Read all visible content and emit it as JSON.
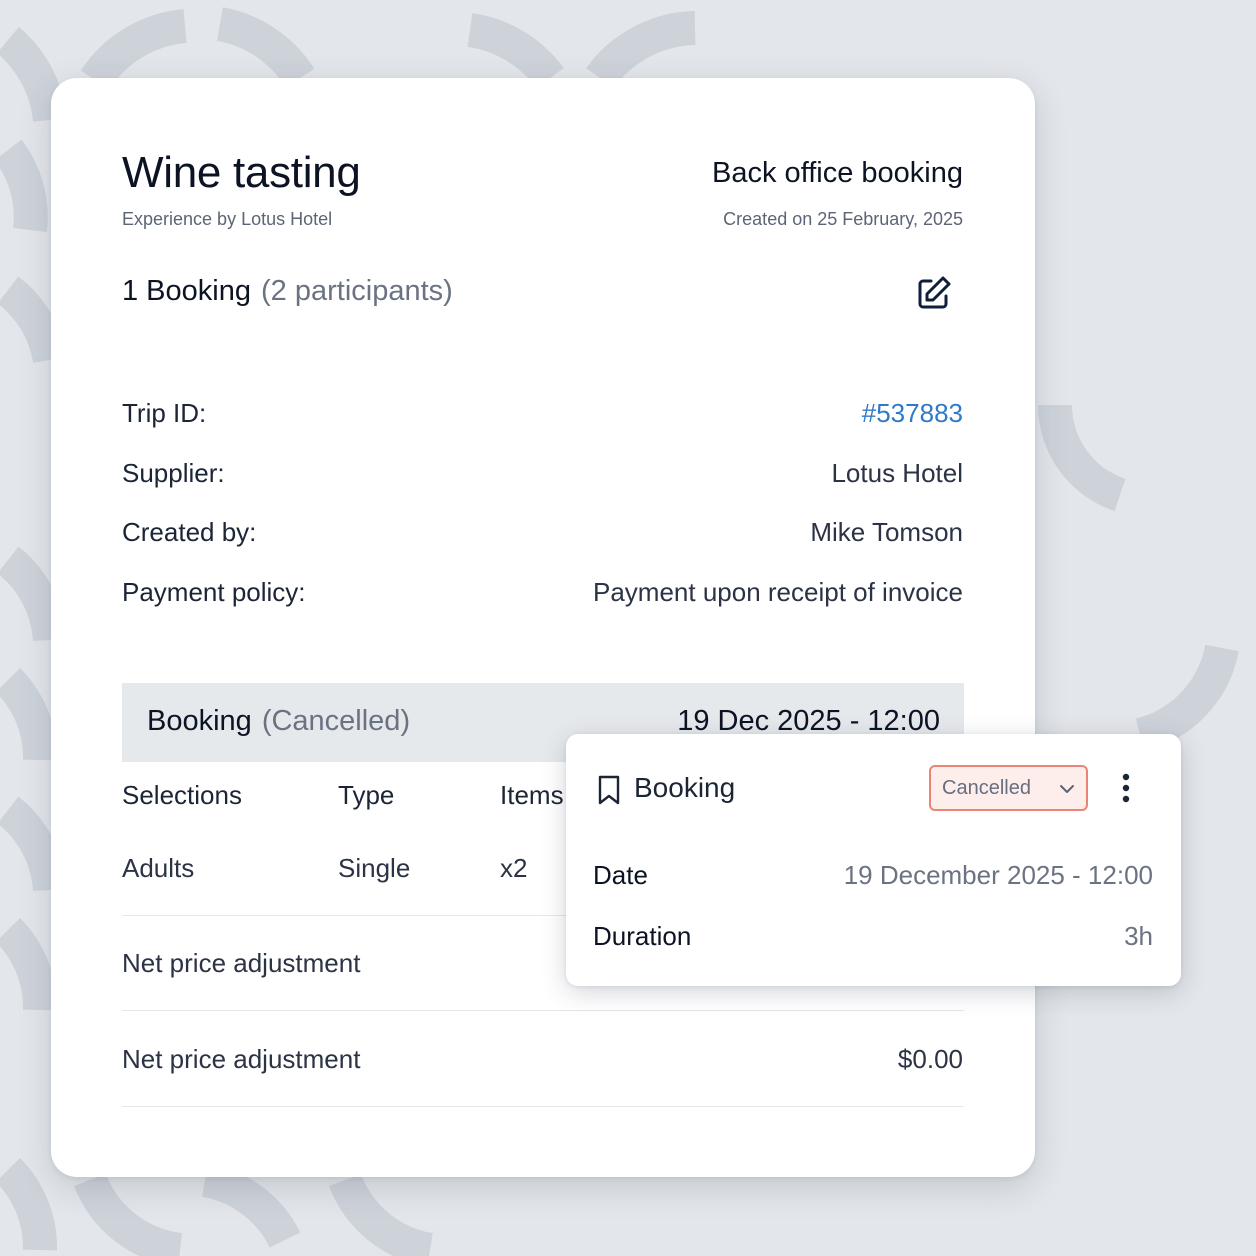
{
  "header": {
    "title": "Wine tasting",
    "subtitle": "Experience by Lotus Hotel",
    "booking_source": "Back office booking",
    "created_on": "Created on 25 February, 2025"
  },
  "summary": {
    "booking_count": "1 Booking",
    "participants": "(2 participants)",
    "edit_icon": "edit-icon"
  },
  "info": {
    "trip_id_label": "Trip ID:",
    "trip_id_value": "#537883",
    "supplier_label": "Supplier:",
    "supplier_value": "Lotus Hotel",
    "created_by_label": "Created by:",
    "created_by_value": "Mike Tomson",
    "payment_policy_label": "Payment policy:",
    "payment_policy_value": "Payment upon receipt of invoice"
  },
  "booking_section": {
    "label": "Booking",
    "status": "(Cancelled)",
    "datetime": "19 Dec 2025 - 12:00",
    "columns": [
      "Selections",
      "Type",
      "Items"
    ],
    "rows": [
      [
        "Adults",
        "Single",
        "x2"
      ]
    ]
  },
  "adjustments": [
    {
      "label": "Net price adjustment",
      "amount": ""
    },
    {
      "label": "Net price adjustment",
      "amount": "$0.00"
    }
  ],
  "popup": {
    "title": "Booking",
    "status_selected": "Cancelled",
    "date_label": "Date",
    "date_value": "19 December 2025 - 12:00",
    "duration_label": "Duration",
    "duration_value": "3h"
  },
  "colors": {
    "link": "#2f79c9",
    "status_border": "#ea8575",
    "status_bg": "#fdeeeb",
    "section_bg": "#e6e9ec"
  }
}
